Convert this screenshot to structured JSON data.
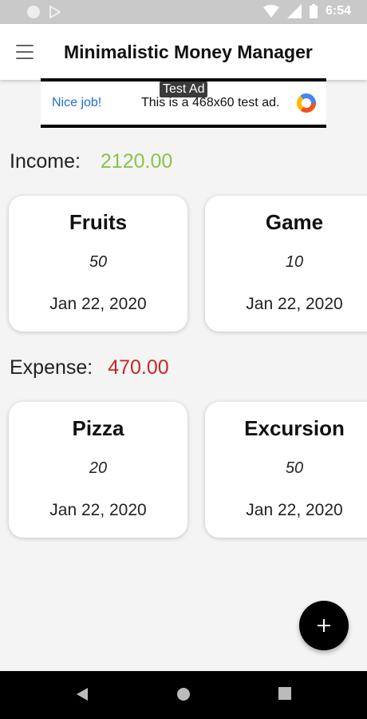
{
  "status_bar": {
    "time": "6:54"
  },
  "app_bar": {
    "title": "Minimalistic Money Manager"
  },
  "ad": {
    "tag": "Test Ad",
    "left_text": "Nice job!",
    "text": "This is a 468x60 test ad."
  },
  "income": {
    "label": "Income:",
    "amount": "2120.00",
    "color": "#8bc34a",
    "items": [
      {
        "name": "Fruits",
        "value": "50",
        "date": "Jan 22, 2020"
      },
      {
        "name": "Game",
        "value": "10",
        "date": "Jan 22, 2020"
      }
    ]
  },
  "expense": {
    "label": "Expense:",
    "amount": "470.00",
    "color": "#c62828",
    "items": [
      {
        "name": "Pizza",
        "value": "20",
        "date": "Jan 22, 2020"
      },
      {
        "name": "Excursion",
        "value": "50",
        "date": "Jan 22, 2020"
      }
    ]
  },
  "icons": {
    "menu": "hamburger-menu-icon",
    "fab": "plus-icon",
    "nav_back": "back-triangle-icon",
    "nav_home": "home-circle-icon",
    "nav_recents": "recents-square-icon"
  }
}
